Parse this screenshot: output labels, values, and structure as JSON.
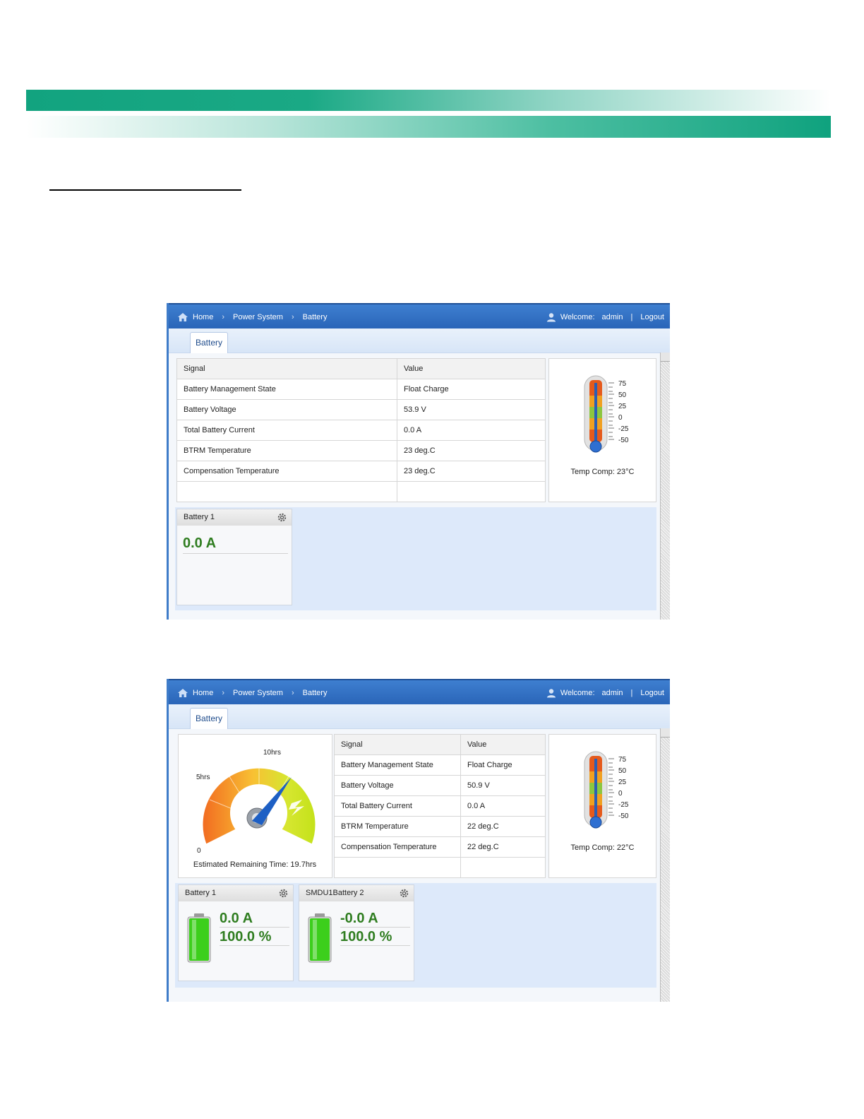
{
  "nav": {
    "home": "Home",
    "power_system": "Power System",
    "battery": "Battery",
    "welcome": "Welcome:",
    "user": "admin",
    "divider": "|",
    "logout": "Logout"
  },
  "tab": {
    "label": "Battery"
  },
  "table_headers": {
    "signal": "Signal",
    "value": "Value"
  },
  "thermo_scale": [
    "75",
    "50",
    "25",
    "0",
    "-25",
    "-50"
  ],
  "screen1": {
    "rows": [
      {
        "signal": "Battery Management State",
        "value": "Float Charge"
      },
      {
        "signal": "Battery Voltage",
        "value": "53.9 V"
      },
      {
        "signal": "Total Battery Current",
        "value": "0.0 A"
      },
      {
        "signal": "BTRM Temperature",
        "value": "23 deg.C"
      },
      {
        "signal": "Compensation Temperature",
        "value": "23 deg.C"
      }
    ],
    "temp_comp": "Temp Comp: 23°C",
    "battery_card": {
      "title": "Battery 1",
      "current": "0.0 A"
    }
  },
  "screen2": {
    "gauge": {
      "label_0": "0",
      "label_5": "5hrs",
      "label_10": "10hrs",
      "estimate": "Estimated Remaining Time: 19.7hrs"
    },
    "rows": [
      {
        "signal": "Battery Management State",
        "value": "Float Charge"
      },
      {
        "signal": "Battery Voltage",
        "value": "50.9 V"
      },
      {
        "signal": "Total Battery Current",
        "value": "0.0 A"
      },
      {
        "signal": "BTRM Temperature",
        "value": "22 deg.C"
      },
      {
        "signal": "Compensation Temperature",
        "value": "22 deg.C"
      }
    ],
    "temp_comp": "Temp Comp: 22°C",
    "cards": [
      {
        "title": "Battery 1",
        "current": "0.0 A",
        "capacity": "100.0 %",
        "capacity_level": 1.0
      },
      {
        "title": "SMDU1Battery 2",
        "current": "-0.0 A",
        "capacity": "100.0 %",
        "capacity_level": 1.0
      }
    ]
  }
}
